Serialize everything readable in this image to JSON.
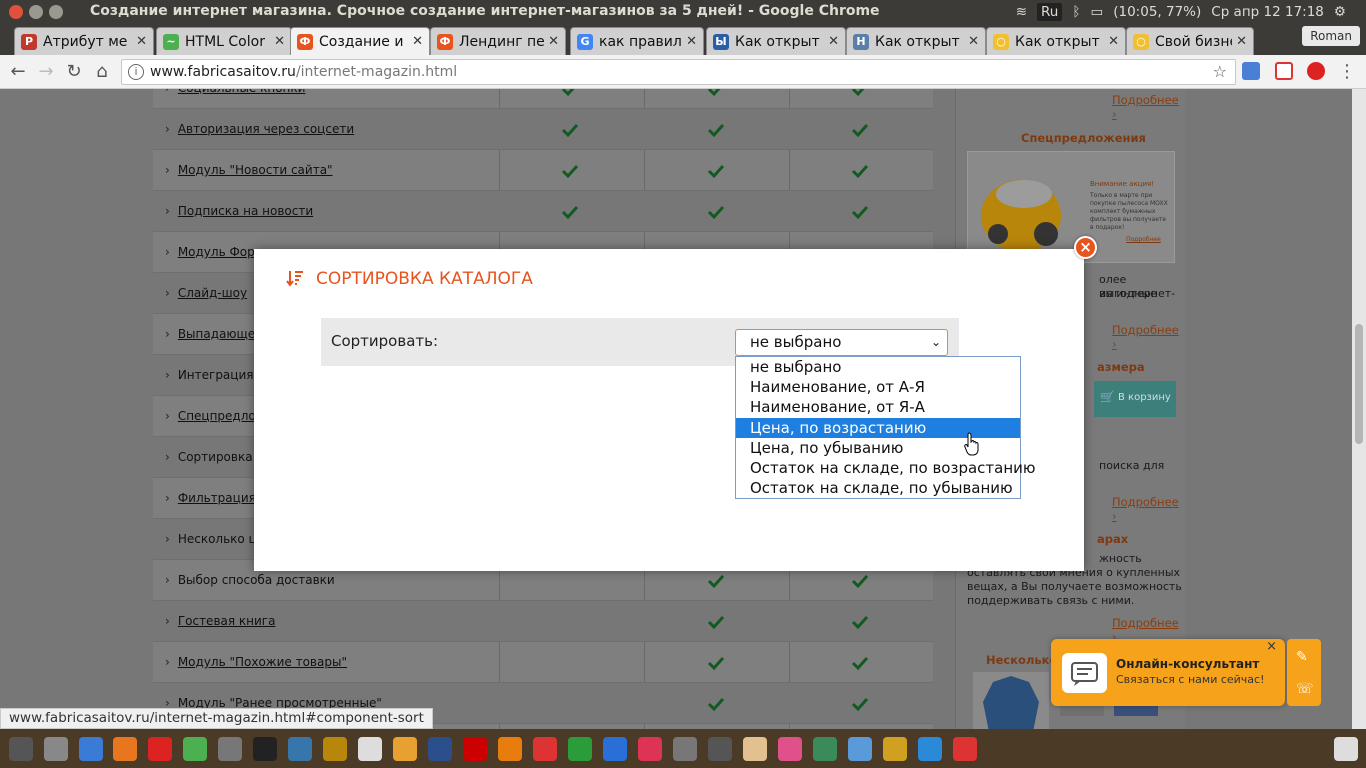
{
  "os": {
    "window_title": "Создание интернет магазина. Срочное создание интернет-магазинов за 5 дней! - Google Chrome",
    "keyboard": "Ru",
    "battery": "(10:05, 77%)",
    "clock": "Ср апр 12 17:18",
    "user": "Roman"
  },
  "tabs": [
    {
      "label": "Атрибут ме",
      "color": "#c0392b",
      "glyph": "Р"
    },
    {
      "label": "HTML Color",
      "color": "#4caf50",
      "glyph": "~"
    },
    {
      "label": "Создание и",
      "color": "#e8541e",
      "glyph": "Ф",
      "active": true
    },
    {
      "label": "Лендинг пе",
      "color": "#e8541e",
      "glyph": "Ф"
    },
    {
      "label": "как правил",
      "color": "#4285f4",
      "glyph": "G"
    },
    {
      "label": "Как открыт",
      "color": "#2a5fa8",
      "glyph": "Ы"
    },
    {
      "label": "Как открыт",
      "color": "#5a7fa8",
      "glyph": "H"
    },
    {
      "label": "Как открыт",
      "color": "#f0c030",
      "glyph": "○"
    },
    {
      "label": "Свой бизне",
      "color": "#f0c030",
      "glyph": "○"
    }
  ],
  "address": {
    "domain": "www.fabricasaitov.ru",
    "path": "/internet-magazin.html"
  },
  "table_rows": [
    {
      "label": "Социальные кнопки",
      "checks": [
        true,
        true,
        true
      ]
    },
    {
      "label": "Авторизация через соцсети",
      "checks": [
        true,
        true,
        true
      ]
    },
    {
      "label": "Модуль \"Новости сайта\"",
      "checks": [
        true,
        true,
        true
      ]
    },
    {
      "label": "Подписка на новости",
      "checks": [
        true,
        true,
        true
      ]
    },
    {
      "label": "Модуль Форм",
      "checks": [
        false,
        false,
        false
      ]
    },
    {
      "label": "Слайд-шоу",
      "checks": [
        false,
        false,
        false
      ]
    },
    {
      "label": "Выпадающее",
      "checks": [
        false,
        false,
        false
      ]
    },
    {
      "label": "Интеграция с",
      "checks": [
        false,
        false,
        false
      ],
      "plain": true
    },
    {
      "label": "Спецпредлож",
      "checks": [
        false,
        false,
        false
      ]
    },
    {
      "label": "Сортировка к",
      "checks": [
        false,
        false,
        false
      ],
      "plain": true
    },
    {
      "label": "Фильтрация т",
      "checks": [
        false,
        false,
        false
      ]
    },
    {
      "label": "Несколько це",
      "checks": [
        false,
        false,
        false
      ],
      "plain": true
    },
    {
      "label": "Выбор способа доставки",
      "checks": [
        false,
        true,
        true
      ],
      "plain": true
    },
    {
      "label": "Гостевая книга",
      "checks": [
        false,
        true,
        true
      ]
    },
    {
      "label": "Модуль \"Похожие товары\"",
      "checks": [
        false,
        true,
        true
      ]
    },
    {
      "label": "Модуль \"Ранее просмотренные\"",
      "checks": [
        false,
        true,
        true
      ]
    }
  ],
  "sidebar": {
    "more_label": "Подробнее ›",
    "specials_heading": "Спецпредложения",
    "promo_title": "Внимание акция!",
    "promo_text": "Только в марте при покупке пылесоса MOXX комплект бумажных фильтров вы получаете в подарок!",
    "promo_link": "Подробнее",
    "text1a": "олее выгодные",
    "text1b": "ия интернет-",
    "heading2": "азмера",
    "cart_button": "В корзину",
    "text2": "поиска для",
    "heading3": "арах",
    "text3a": "жность",
    "text3b": "оставлять свои мнения о купленных",
    "text3c": "вещах, а Вы получаете возможность",
    "text3d": "поддерживать связь с ними.",
    "heading4": "Несколько с"
  },
  "modal": {
    "title": "СОРТИРОВКА КАТАЛОГА",
    "sort_label": "Сортировать:",
    "selected_value": "не выбрано",
    "close": "×",
    "options": [
      "не выбрано",
      "Наименование, от А-Я",
      "Наименование, от Я-А",
      "Цена, по возрастанию",
      "Цена, по убыванию",
      "Остаток на складе, по возрастанию",
      "Остаток на складе, по убыванию"
    ],
    "highlighted_index": 3
  },
  "consultant": {
    "title": "Онлайн-консультант",
    "subtitle": "Связаться с нами сейчас!",
    "close": "×"
  },
  "status_url": "www.fabricasaitov.ru/internet-magazin.html#component-sort",
  "colors": {
    "accent": "#e8541e",
    "check": "#1e9b3c",
    "highlight": "#1e7fe0",
    "consult": "#f6a21b"
  }
}
